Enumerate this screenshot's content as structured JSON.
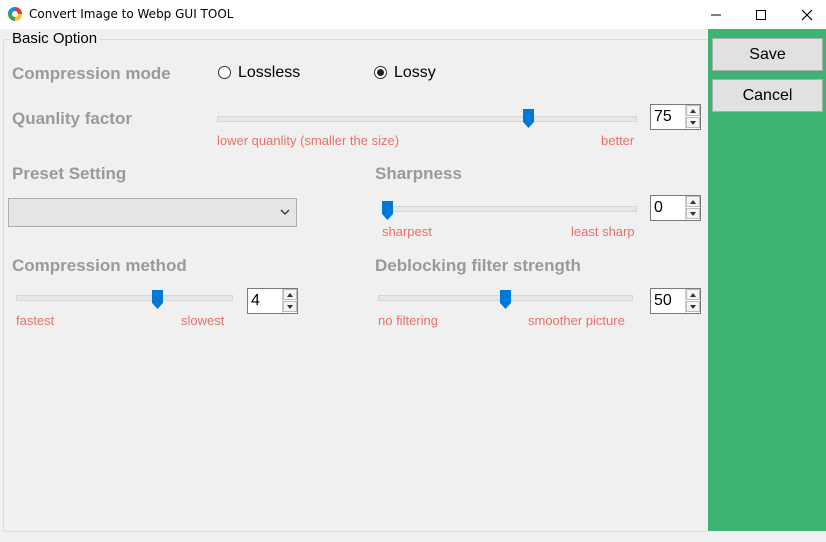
{
  "window": {
    "title": "Convert Image to Webp GUI TOOL",
    "minimize_icon": "minimize-icon",
    "maximize_icon": "maximize-icon",
    "close_icon": "close-icon"
  },
  "group_title": "Basic Option",
  "compression_mode": {
    "label": "Compression mode",
    "options": [
      "Lossless",
      "Lossy"
    ],
    "selected": "Lossy"
  },
  "quality": {
    "label": "Quanlity factor",
    "value": "75",
    "min": 0,
    "max": 100,
    "hint_low": "lower quanlity (smaller the size)",
    "hint_high": "better"
  },
  "preset": {
    "label": "Preset Setting",
    "value": ""
  },
  "sharpness": {
    "label": "Sharpness",
    "value": "0",
    "min": 0,
    "max": 7,
    "hint_low": "sharpest",
    "hint_high": "least sharp"
  },
  "method": {
    "label": "Compression method",
    "value": "4",
    "min": 0,
    "max": 6,
    "hint_low": "fastest",
    "hint_high": "slowest"
  },
  "deblocking": {
    "label": "Deblocking filter strength",
    "value": "50",
    "min": 0,
    "max": 100,
    "hint_low": "no filtering",
    "hint_high": "smoother picture"
  },
  "buttons": {
    "save": "Save",
    "cancel": "Cancel"
  },
  "colors": {
    "sidebar": "#3cb371",
    "accent": "#0078d7",
    "hint": "#e8706a",
    "label": "#9a9a9a"
  }
}
